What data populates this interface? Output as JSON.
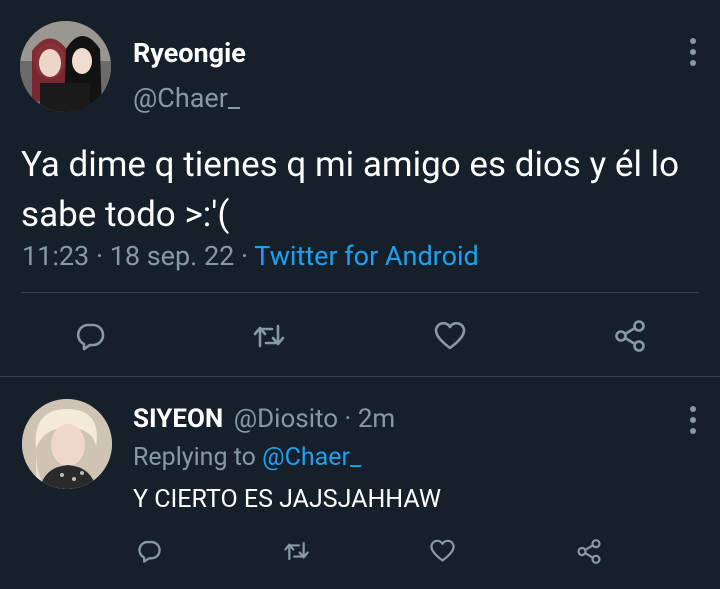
{
  "main_tweet": {
    "display_name": "Ryeongie",
    "handle": "@Chaer_",
    "text": "Ya dime q tienes q mi amigo es dios y él lo sabe todo >:'(",
    "time": "11:23",
    "separator": " · ",
    "date": "18 sep. 22",
    "source": "Twitter for Android"
  },
  "reply": {
    "display_name": "SIYEON",
    "handle": "@Diosito",
    "separator": " · ",
    "age": "2m",
    "replying_prefix": "Replying to ",
    "replying_to": "@Chaer_",
    "text": "Y CIERTO ES JAJSJAHHAW"
  },
  "icons": [
    "reply-icon",
    "retweet-icon",
    "like-icon",
    "share-icon",
    "more-options-icon"
  ],
  "colors": {
    "background": "#15202b",
    "secondary_text": "#8899a6",
    "link": "#1da1f2",
    "divider": "#38444d"
  }
}
